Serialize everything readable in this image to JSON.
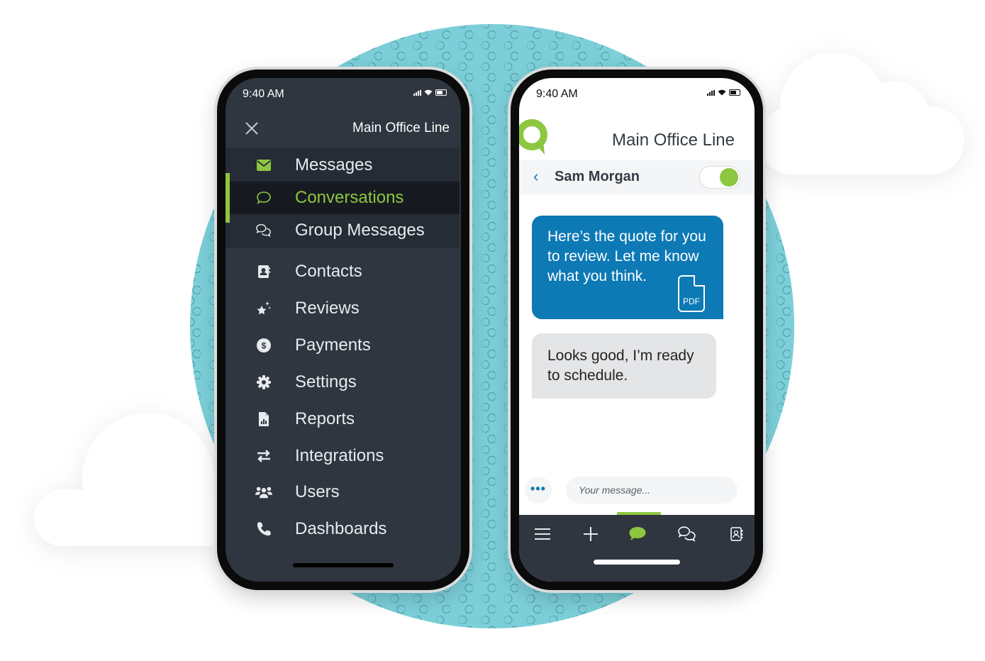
{
  "colors": {
    "accent_green": "#8dc63f",
    "brand_blue": "#0d79b5",
    "dark_bg": "#2f3640",
    "teal_bg": "#7ccfd9"
  },
  "left_phone": {
    "status_time": "9:40 AM",
    "header_title": "Main Office Line",
    "close_icon": "close-icon",
    "menu": [
      {
        "label": "Messages",
        "icon": "envelope-icon",
        "active": false,
        "group": true
      },
      {
        "label": "Conversations",
        "icon": "chat-bubble-icon",
        "active": true,
        "group": true
      },
      {
        "label": "Group Messages",
        "icon": "group-chat-icon",
        "active": false,
        "group": true
      },
      {
        "label": "Contacts",
        "icon": "contact-book-icon",
        "active": false
      },
      {
        "label": "Reviews",
        "icon": "star-sparkle-icon",
        "active": false
      },
      {
        "label": "Payments",
        "icon": "dollar-circle-icon",
        "active": false
      },
      {
        "label": "Settings",
        "icon": "gear-icon",
        "active": false
      },
      {
        "label": "Reports",
        "icon": "report-file-icon",
        "active": false
      },
      {
        "label": "Integrations",
        "icon": "swap-arrows-icon",
        "active": false
      },
      {
        "label": "Users",
        "icon": "users-icon",
        "active": false
      },
      {
        "label": "Dashboards",
        "icon": "phone-icon",
        "active": false
      }
    ]
  },
  "right_phone": {
    "status_time": "9:40 AM",
    "header_title": "Main Office Line",
    "contact_name": "Sam Morgan",
    "toggle_on": true,
    "messages": [
      {
        "direction": "outgoing",
        "text": "Here’s the quote for you to review. Let me know what you think.",
        "attachment": "PDF"
      },
      {
        "direction": "incoming",
        "text": "Looks good, I’m ready to schedule."
      }
    ],
    "input_placeholder": "Your message...",
    "more_label": "•••",
    "tabs": [
      {
        "name": "menu",
        "icon": "hamburger-menu-icon",
        "active": false
      },
      {
        "name": "new",
        "icon": "plus-icon",
        "active": false
      },
      {
        "name": "conversations",
        "icon": "chat-bubble-icon",
        "active": true
      },
      {
        "name": "group-messages",
        "icon": "group-chat-icon",
        "active": false
      },
      {
        "name": "contacts",
        "icon": "contact-book-icon",
        "active": false
      }
    ]
  }
}
